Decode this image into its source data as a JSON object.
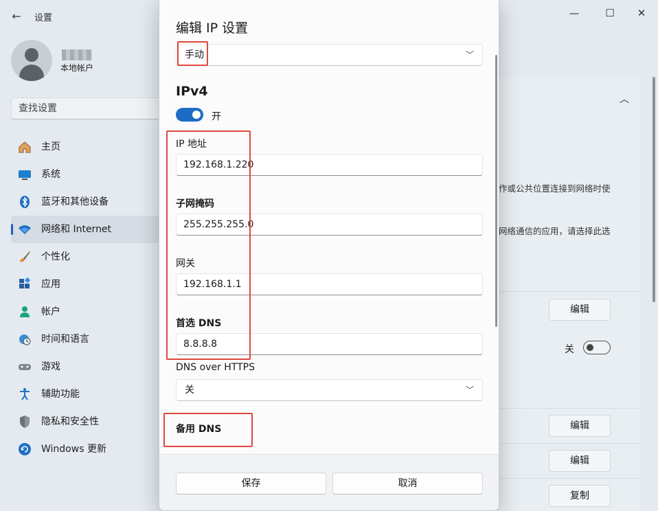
{
  "window": {
    "title": "设置",
    "back_glyph": "←",
    "minimize_glyph": "—",
    "maximize_glyph": "☐",
    "close_glyph": "✕"
  },
  "profile": {
    "account_type": "本地帐户"
  },
  "search": {
    "placeholder": "查找设置"
  },
  "nav": {
    "items": [
      {
        "label": "主页",
        "icon": "home-icon"
      },
      {
        "label": "系统",
        "icon": "monitor-icon"
      },
      {
        "label": "蓝牙和其他设备",
        "icon": "bluetooth-icon"
      },
      {
        "label": "网络和 Internet",
        "icon": "wifi-icon",
        "active": true
      },
      {
        "label": "个性化",
        "icon": "brush-icon"
      },
      {
        "label": "应用",
        "icon": "apps-icon"
      },
      {
        "label": "帐户",
        "icon": "person-icon"
      },
      {
        "label": "时间和语言",
        "icon": "globe-clock-icon"
      },
      {
        "label": "游戏",
        "icon": "gamepad-icon"
      },
      {
        "label": "辅助功能",
        "icon": "accessibility-icon"
      },
      {
        "label": "隐私和安全性",
        "icon": "shield-icon"
      },
      {
        "label": "Windows 更新",
        "icon": "update-icon"
      }
    ]
  },
  "background_panel": {
    "text_line_1": "作或公共位置连接到网络时使",
    "text_line_2": "网络通信的应用，请选择此选",
    "edit_label": "编辑",
    "toggle_state_label": "关",
    "copy_label": "复制"
  },
  "dialog": {
    "title": "编辑 IP 设置",
    "mode": {
      "value": "手动"
    },
    "ipv4": {
      "title": "IPv4",
      "toggle_label": "开",
      "enabled": true
    },
    "fields": {
      "ip_label": "IP 地址",
      "ip_value": "192.168.1.220",
      "subnet_label": "子网掩码",
      "subnet_value": "255.255.255.0",
      "gateway_label": "网关",
      "gateway_value": "192.168.1.1",
      "dns_label": "首选 DNS",
      "dns_value": "8.8.8.8",
      "doh_label": "DNS over HTTPS",
      "doh_value": "关",
      "alt_dns_label": "备用 DNS"
    },
    "save_label": "保存",
    "cancel_label": "取消"
  },
  "colors": {
    "accent": "#1c6cc5",
    "annotation": "#e0463c"
  }
}
